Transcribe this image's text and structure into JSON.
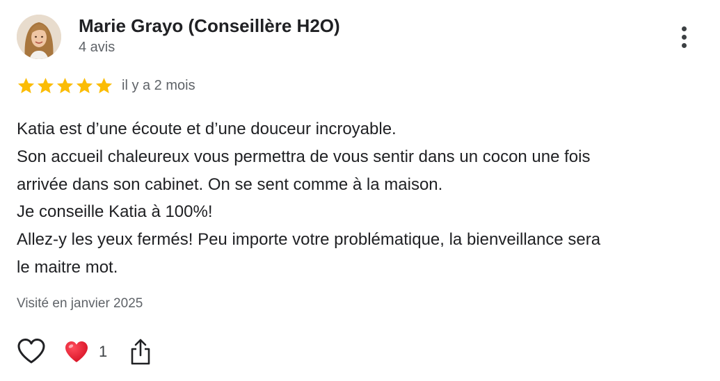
{
  "review": {
    "author": {
      "name": "Marie Grayo (Conseillère H2O)",
      "review_count": "4 avis",
      "avatar_icon": "user-photo-avatar"
    },
    "rating": {
      "stars": 5,
      "max_stars": 5,
      "star_color": "#fbbc04"
    },
    "date": "il y a 2 mois",
    "text_lines": [
      "Katia est d’une écoute et d’une douceur incroyable.",
      "Son accueil chaleureux vous permettra de vous sentir dans un cocon une fois",
      "arrivée dans son cabinet. On se sent comme à la maison.",
      "Je conseille Katia à 100%!",
      "Allez-y les yeux fermés! Peu importe votre problématique, la bienveillance sera",
      "le maitre mot."
    ],
    "visited": "Visité en janvier 2025",
    "actions": {
      "like_icon": "heart-outline-icon",
      "reaction_icon": "red-heart-emoji-icon",
      "reaction_count": "1",
      "share_icon": "share-icon",
      "more_icon": "more-vertical-icon"
    }
  }
}
